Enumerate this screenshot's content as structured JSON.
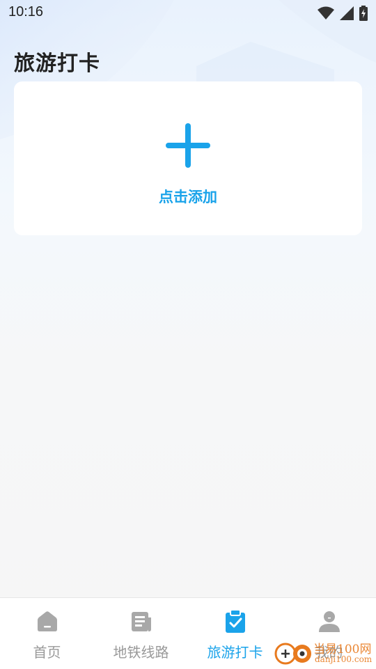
{
  "status_bar": {
    "time": "10:16",
    "icons": [
      "wifi-icon",
      "cellular-signal-icon",
      "battery-charging-icon"
    ]
  },
  "page": {
    "title": "旅游打卡"
  },
  "add_card": {
    "icon": "plus-icon",
    "label": "点击添加",
    "accent_color": "#1aa3ea"
  },
  "tabbar": {
    "active_color": "#1aa3ea",
    "inactive_color": "#999999",
    "tabs": [
      {
        "label": "首页",
        "icon": "home-icon",
        "active": false
      },
      {
        "label": "地铁线路",
        "icon": "document-icon",
        "active": false
      },
      {
        "label": "旅游打卡",
        "icon": "clipboard-check-icon",
        "active": true
      },
      {
        "label": "我的",
        "icon": "user-icon",
        "active": false
      }
    ]
  },
  "watermark": {
    "text": "当易100网",
    "sub": "danji100.com"
  }
}
